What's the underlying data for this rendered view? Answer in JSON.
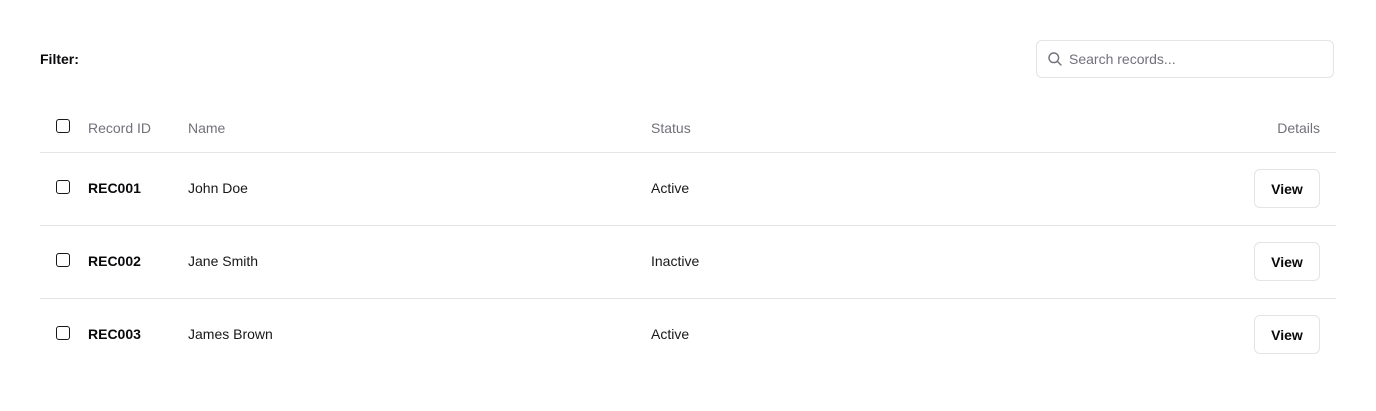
{
  "filter": {
    "label": "Filter:"
  },
  "search": {
    "placeholder": "Search records...",
    "value": ""
  },
  "table": {
    "headers": {
      "record_id": "Record ID",
      "name": "Name",
      "status": "Status",
      "details": "Details"
    },
    "rows": [
      {
        "record_id": "REC001",
        "name": "John Doe",
        "status": "Active",
        "action": "View",
        "checked": false
      },
      {
        "record_id": "REC002",
        "name": "Jane Smith",
        "status": "Inactive",
        "action": "View",
        "checked": false
      },
      {
        "record_id": "REC003",
        "name": "James Brown",
        "status": "Active",
        "action": "View",
        "checked": false
      }
    ]
  },
  "icons": {
    "search": "search-icon",
    "checkbox": "checkbox-icon"
  },
  "colors": {
    "border": "#e4e4e7",
    "muted_text": "#71717a",
    "text": "#18181b"
  }
}
